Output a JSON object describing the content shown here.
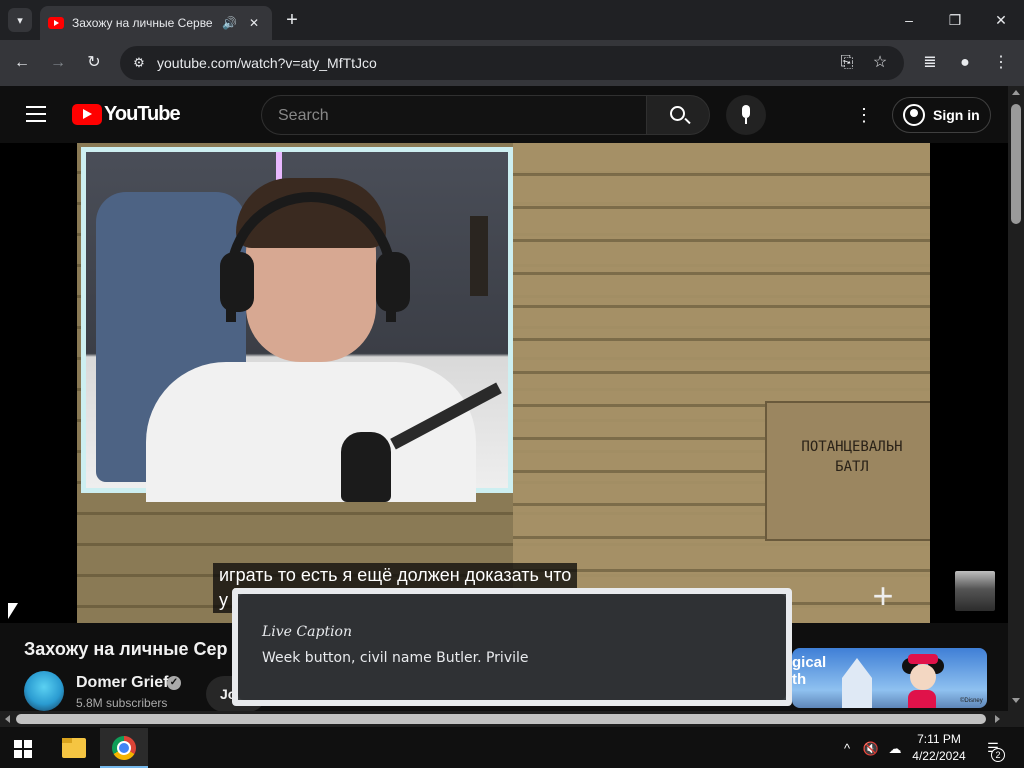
{
  "browser": {
    "tab": {
      "title": "Захожу на личные Серве",
      "audio_icon": "speaker-icon",
      "close_icon": "close-icon"
    },
    "tab_search_icon": "chevron-down-icon",
    "new_tab_symbol": "+",
    "window_controls": {
      "minimize": "–",
      "maximize": "❐",
      "close": "✕"
    },
    "toolbar": {
      "back": "←",
      "forward": "→",
      "reload": "↻",
      "url": "youtube.com/watch?v=aty_MfTtJco",
      "install_icon": "⎘",
      "bookmark": "☆",
      "media": "≣",
      "profile": "●",
      "menu": "⋮"
    }
  },
  "youtube": {
    "logo_text": "YouTube",
    "search": {
      "placeholder": "Search"
    },
    "more_icon": "⋮",
    "sign_in_label": "Sign in"
  },
  "video": {
    "sign_text": "ПОТАНЦЕВАЛЬН\nБАТЛ",
    "subtitle_line1": "играть то есть я ещё должен доказать что",
    "subtitle_line2": "у",
    "add_symbol": "+"
  },
  "below_video": {
    "title": "Захожу на личные Сер",
    "channel_name": "Domer Grief",
    "verified_mark": "✓",
    "subscribers": "5.8M subscribers",
    "join_label": "Jo",
    "ad_text": "gical\nth",
    "ad_copyright": "©Disney"
  },
  "live_caption": {
    "title": "Live Caption",
    "text": "Week button, civil name Butler. Privile"
  },
  "taskbar": {
    "tray_chevron": "^",
    "volume": "🔇",
    "network": "☁",
    "time": "7:11 PM",
    "date": "4/22/2024",
    "notifications_icon": "☰",
    "notification_count": "2"
  },
  "colors": {
    "youtube_red": "#ff0000",
    "page_bg": "#0f0f0f",
    "chrome_toolbar": "#35363a"
  }
}
